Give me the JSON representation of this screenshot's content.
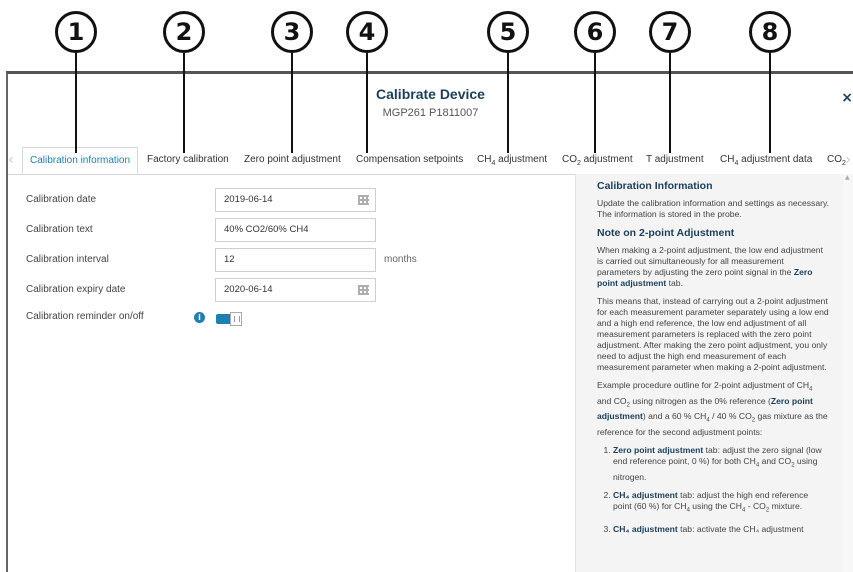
{
  "callouts": [
    "1",
    "2",
    "3",
    "4",
    "5",
    "6",
    "7",
    "8"
  ],
  "dialog": {
    "title": "Calibrate Device",
    "subtitle": "MGP261 P1811007",
    "close_glyph": "×"
  },
  "tabs": [
    {
      "label": "Calibration information",
      "active": true
    },
    {
      "label": "Factory calibration"
    },
    {
      "label": "Zero point adjustment"
    },
    {
      "label": "Compensation setpoints"
    },
    {
      "label_pre": "CH",
      "label_sub": "4",
      "label_post": " adjustment"
    },
    {
      "label_pre": "CO",
      "label_sub": "2",
      "label_post": " adjustment"
    },
    {
      "label": "T adjustment"
    },
    {
      "label_pre": "CH",
      "label_sub": "4",
      "label_post": " adjustment data"
    },
    {
      "label_pre": "CO",
      "label_sub": "2",
      "label_post": ""
    }
  ],
  "form": {
    "calibration_date": {
      "label": "Calibration date",
      "value": "2019-06-14"
    },
    "calibration_text": {
      "label": "Calibration text",
      "value": "40% CO2/60% CH4"
    },
    "calibration_interval": {
      "label": "Calibration interval",
      "value": "12",
      "unit": "months"
    },
    "calibration_expiry_date": {
      "label": "Calibration expiry date",
      "value": "2020-06-14"
    },
    "calibration_reminder": {
      "label": "Calibration reminder on/off",
      "state": "on"
    }
  },
  "help": {
    "heading1": "Calibration Information",
    "p1": "Update the calibration information and settings as necessary. The information is stored in the probe.",
    "heading2": "Note on 2-point Adjustment",
    "p2_a": "When making a 2-point adjustment, the low end adjustment is carried out simultaneously for all measurement parameters by adjusting the zero point signal in the ",
    "p2_b": "Zero point adjustment",
    "p2_c": " tab.",
    "p3": "This means that, instead of carrying out a 2-point adjustment for each measurement parameter separately using a low end and a high end reference, the low end adjustment of all measurement parameters is replaced with the zero point adjustment. After making the zero point adjustment, you only need to adjust the high end measurement of each measurement parameter when making a 2-point adjustment.",
    "p4_a": "Example procedure outline for 2-point adjustment of CH",
    "p4_b": " and CO",
    "p4_c": " using nitrogen as the 0% reference (",
    "p4_bold": "Zero point adjustment",
    "p4_d": ") and a 60 % CH",
    "p4_e": " / 40 % CO",
    "p4_f": " gas mixture as the reference for the second adjustment points:",
    "li1_bold": "Zero point adjustment",
    "li1_a": " tab: adjust the zero signal (low end reference point, 0 %) for both CH",
    "li1_b": " and CO",
    "li1_c": " using nitrogen.",
    "li2_bold": "CH₄ adjustment",
    "li2_a": " tab: adjust the high end reference point (60 %) for CH",
    "li2_b": " using the CH",
    "li2_c": " - CO",
    "li2_d": " mixture.",
    "li3_bold": "CH₄ adjustment",
    "li3_a": " tab: activate the CH₄ adjustment",
    "sub4": "4",
    "sub2": "2"
  }
}
